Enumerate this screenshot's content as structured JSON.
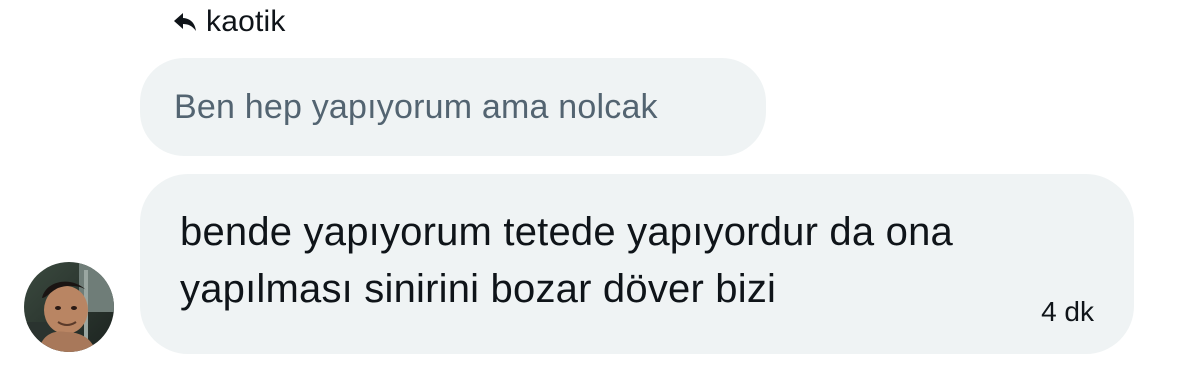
{
  "reply": {
    "icon": "reply-arrow-icon",
    "target_name": "kaotik"
  },
  "quoted_message": {
    "text": "Ben hep yapıyorum ama nolcak"
  },
  "message": {
    "lines": [
      "bende yapıyorum tetede yapıyordur da ona",
      "yapılması sinirini bozar döver bizi"
    ],
    "time": "4 dk"
  },
  "avatar": {
    "icon": "user-avatar-photo"
  },
  "colors": {
    "bubble_bg": "#eff3f4",
    "quoted_text": "#536471",
    "primary_text": "#0f1419"
  }
}
